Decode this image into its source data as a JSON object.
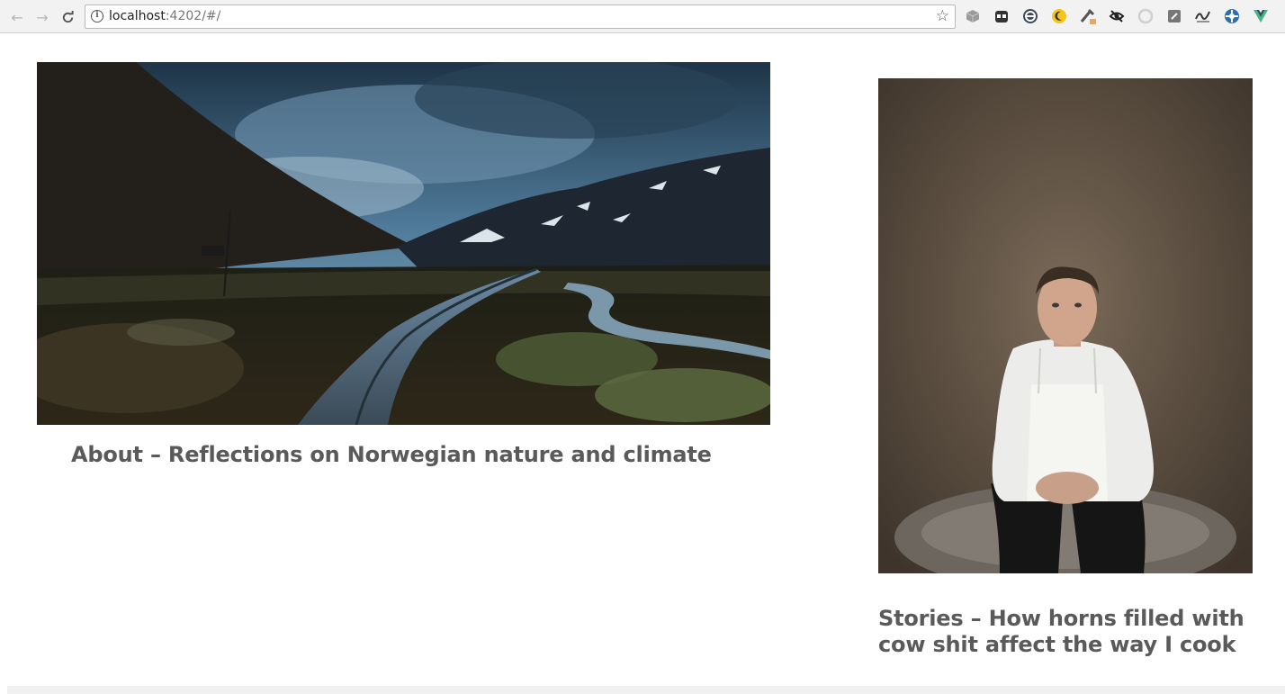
{
  "browser": {
    "back_icon": "arrow-left-icon",
    "forward_icon": "arrow-right-icon",
    "reload_icon": "reload-icon",
    "url_host": "localhost",
    "url_rest": ":4202/#/",
    "bookmark_icon": "star-icon",
    "extensions": [
      "cube-icon",
      "bot-icon",
      "circle-e-icon",
      "moon-icon",
      "eyedropper-icon",
      "eye-slash-icon",
      "ring-icon",
      "note-icon",
      "signature-icon",
      "wheel-icon",
      "vue-icon"
    ]
  },
  "cards": {
    "about": {
      "title": "About – Reflections on Norwegian nature and climate",
      "image": "mountain-valley-road-photo"
    },
    "stories": {
      "title": "Stories – How horns filled with cow shit affect the way I cook",
      "image": "chef-portrait-photo"
    }
  },
  "colors": {
    "title_text": "#5a5a5a",
    "chrome_bg": "#f2f2f2"
  }
}
